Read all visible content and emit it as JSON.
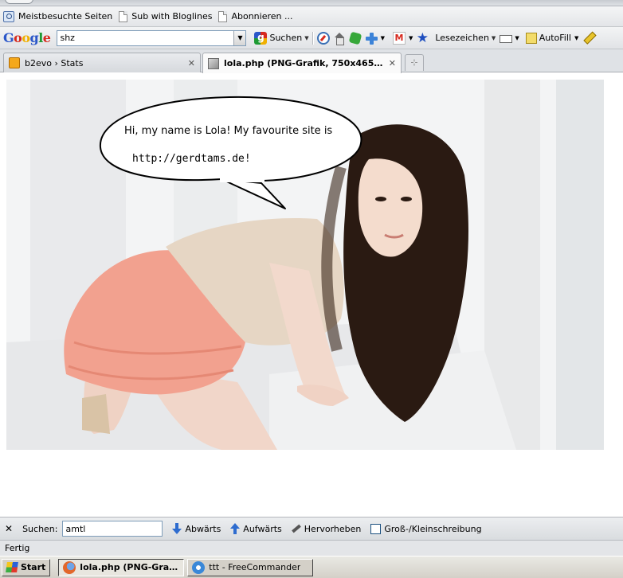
{
  "bookmarks": {
    "items": [
      {
        "label": "Meistbesuchte Seiten",
        "icon": "search-folder-icon"
      },
      {
        "label": "Sub with Bloglines",
        "icon": "page-icon"
      },
      {
        "label": "Abonnieren ...",
        "icon": "page-icon"
      }
    ]
  },
  "google_toolbar": {
    "logo": "Google",
    "search_value": "shz",
    "search_button": "Suchen",
    "bookmarks_label": "Lesezeichen",
    "autofill_label": "AutoFill"
  },
  "tabs": [
    {
      "label": "b2evo › Stats",
      "active": false
    },
    {
      "label": "lola.php (PNG-Grafik, 750x465 Pi...",
      "active": true
    }
  ],
  "page": {
    "image_caption_line1": "Hi, my name is Lola! My favourite site is",
    "image_caption_line2": "http://gerdtams.de!"
  },
  "find_bar": {
    "label": "Suchen:",
    "value": "amtl",
    "down_label": "Abwärts",
    "up_label": "Aufwärts",
    "highlight_label": "Hervorheben",
    "match_case_label": "Groß-/Kleinschreibung"
  },
  "status": {
    "text": "Fertig"
  },
  "taskbar": {
    "start_label": "Start",
    "tasks": [
      {
        "label": "lola.php (PNG-Grafik...",
        "active": true
      },
      {
        "label": "ttt - FreeCommander",
        "active": false
      }
    ]
  },
  "colors": {
    "link_blue": "#2b57c9",
    "skirt": "#f2a18f",
    "top": "#e6d6c4",
    "hair": "#2a1a12"
  }
}
